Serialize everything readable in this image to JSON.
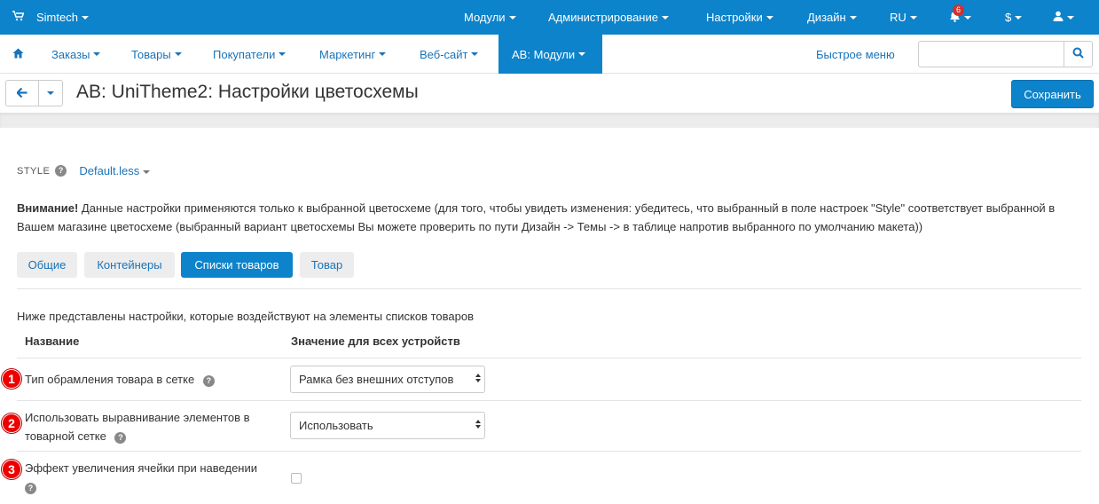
{
  "topbar": {
    "brand": "Simtech",
    "menu": [
      "Модули",
      "Администрирование",
      "Настройки",
      "Дизайн",
      "RU"
    ],
    "notifications_count": "6",
    "currency": "$"
  },
  "nav": {
    "items": [
      "Заказы",
      "Товары",
      "Покупатели",
      "Маркетинг",
      "Веб-сайт",
      "AB: Модули"
    ],
    "quick_menu": "Быстрое меню",
    "search_placeholder": ""
  },
  "title": {
    "text": "AB: UniTheme2: Настройки цветосхемы",
    "save_label": "Сохранить"
  },
  "style": {
    "label": "STYLE",
    "value": "Default.less"
  },
  "notice": {
    "bold": "Внимание!",
    "text": " Данные настройки применяются только к выбранной цветосхеме (для того, чтобы увидеть изменения: убедитесь, что выбранный в поле настроек \"Style\" соответствует выбранной в Вашем магазине цветосхеме (выбранный вариант цветосхемы Вы можете проверить по пути Дизайн -> Темы -> в таблице напротив выбранного по умолчанию макета))"
  },
  "tabs": [
    "Общие",
    "Контейнеры",
    "Списки товаров",
    "Товар"
  ],
  "intro": "Ниже представлены настройки, которые воздействуют на элементы списков товаров",
  "table": {
    "col_name": "Название",
    "col_value": "Значение для всех устройств"
  },
  "rows": [
    {
      "marker": "1",
      "label": "Тип обрамления товара в сетке",
      "value": "Рамка без внешних отступов"
    },
    {
      "marker": "2",
      "label_line1": "Использовать выравнивание элементов в",
      "label_line2": "товарной сетке",
      "value": "Использовать"
    },
    {
      "marker": "3",
      "label": "Эффект увеличения ячейки при наведении",
      "checked": false
    }
  ],
  "colors": {
    "primary": "#0c83cb",
    "link": "#1a73b8",
    "marker": "#e00000"
  }
}
